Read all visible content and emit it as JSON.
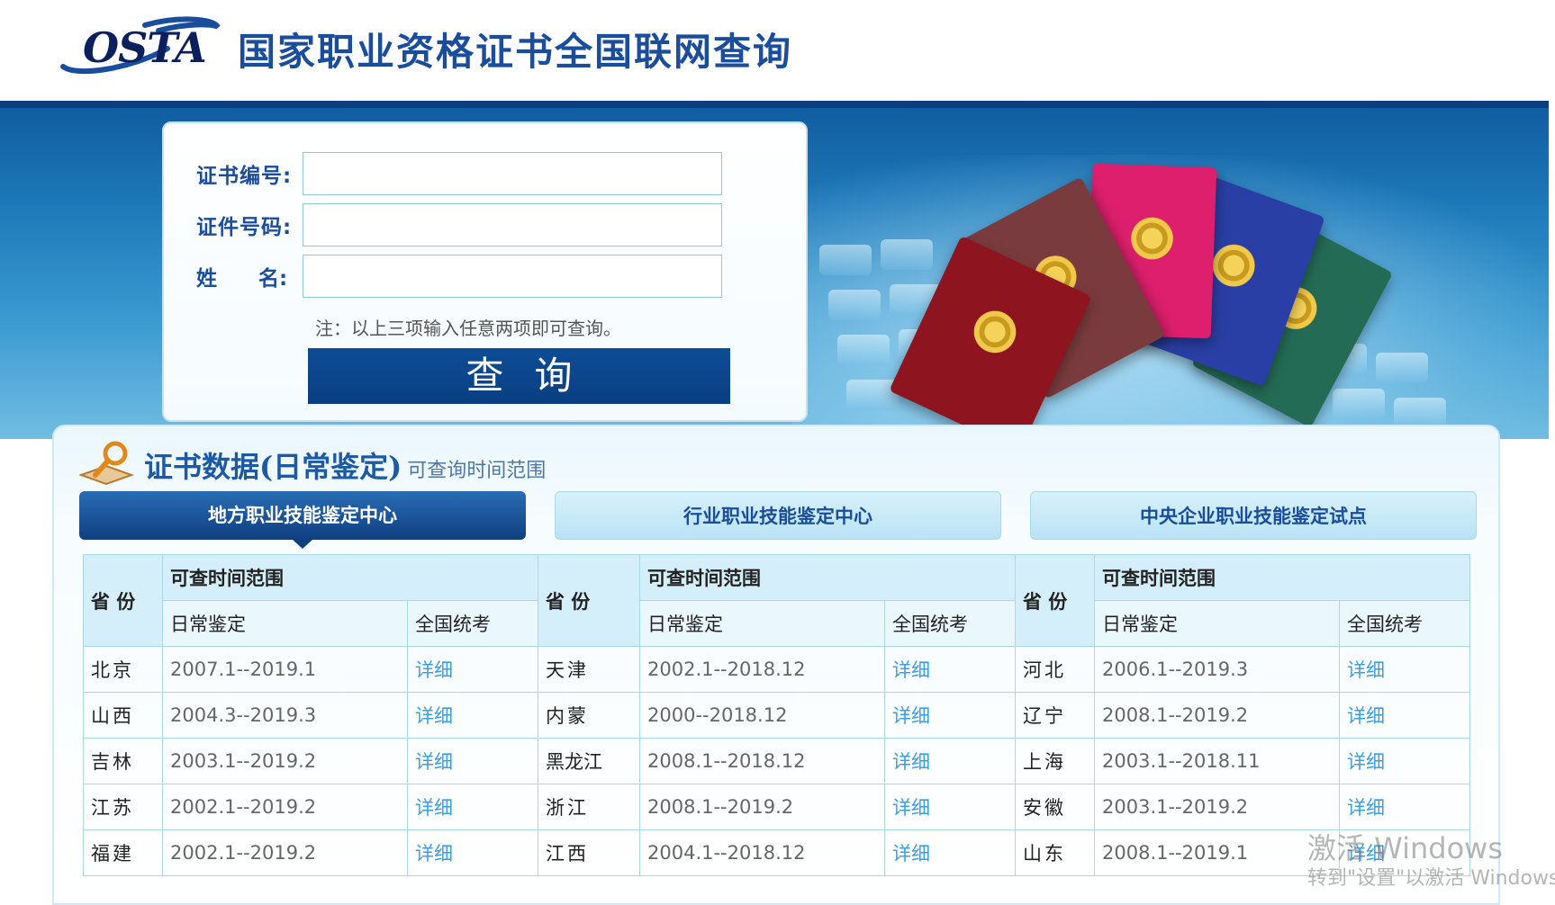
{
  "header": {
    "logo_text": "OSTA",
    "title": "国家职业资格证书全国联网查询"
  },
  "form": {
    "cert_no_label": "证书编号:",
    "id_no_label": "证件号码:",
    "name_label": "姓　　名:",
    "cert_no_value": "",
    "id_no_value": "",
    "name_value": "",
    "note": "注：以上三项输入任意两项即可查询。",
    "query_button": "查询"
  },
  "section": {
    "title": "证书数据(日常鉴定)",
    "subtitle": "可查询时间范围"
  },
  "tabs": [
    {
      "label": "地方职业技能鉴定中心",
      "active": true
    },
    {
      "label": "行业职业技能鉴定中心",
      "active": false
    },
    {
      "label": "中央企业职业技能鉴定试点",
      "active": false
    }
  ],
  "table": {
    "province_header": "省 份",
    "range_header": "可查时间范围",
    "daily_header": "日常鉴定",
    "national_header": "全国统考",
    "detail_link": "详细",
    "rows": [
      [
        {
          "p": "北京",
          "r": "2007.1--2019.1"
        },
        {
          "p": "天津",
          "r": "2002.1--2018.12"
        },
        {
          "p": "河北",
          "r": "2006.1--2019.3"
        }
      ],
      [
        {
          "p": "山西",
          "r": "2004.3--2019.3"
        },
        {
          "p": "内蒙",
          "r": "2000--2018.12"
        },
        {
          "p": "辽宁",
          "r": "2008.1--2019.2"
        }
      ],
      [
        {
          "p": "吉林",
          "r": "2003.1--2019.2"
        },
        {
          "p": "黑龙江",
          "r": "2008.1--2018.12"
        },
        {
          "p": "上海",
          "r": "2003.1--2018.11"
        }
      ],
      [
        {
          "p": "江苏",
          "r": "2002.1--2019.2"
        },
        {
          "p": "浙江",
          "r": "2008.1--2019.2"
        },
        {
          "p": "安徽",
          "r": "2003.1--2019.2"
        }
      ],
      [
        {
          "p": "福建",
          "r": "2002.1--2019.2"
        },
        {
          "p": "江西",
          "r": "2004.1--2018.12"
        },
        {
          "p": "山东",
          "r": "2008.1--2019.1"
        }
      ]
    ]
  },
  "watermark": {
    "line1": "激活 Windows",
    "line2": "转到\"设置\"以激活 Windows。"
  },
  "colors": {
    "brand_blue": "#1a4d9c",
    "banner_blue": "#1d78b8",
    "link_blue": "#3aa0e6",
    "header_cell": "#d4eff9"
  }
}
